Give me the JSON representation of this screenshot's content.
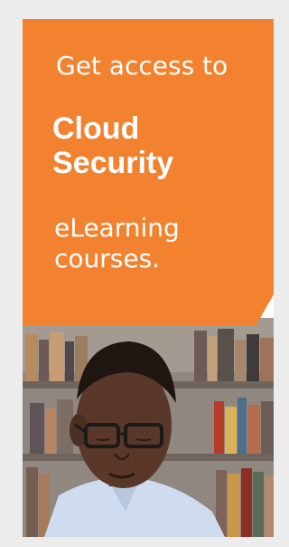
{
  "ad": {
    "headline": "Get access to",
    "topic_line1": "Cloud",
    "topic_line2": "Security",
    "sub_line1": "eLearning",
    "sub_line2": "courses."
  },
  "colors": {
    "page_background": "#ececec",
    "panel": "#f2822f",
    "text": "#ffffff"
  },
  "image": {
    "subject": "man-with-glasses-reading-photo"
  }
}
